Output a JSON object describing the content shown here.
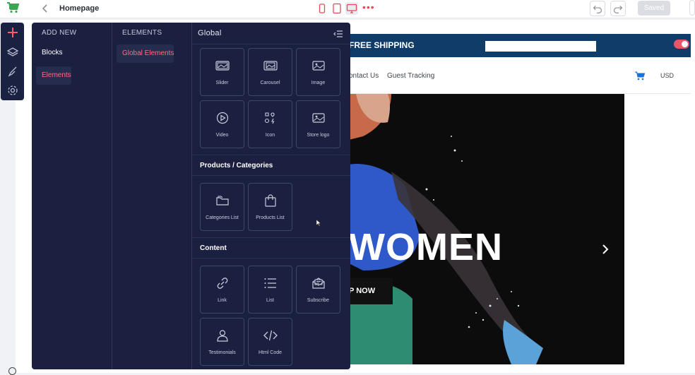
{
  "topbar": {
    "page_name": "Homepage",
    "more": "•••",
    "saved_label": "Saved",
    "icons": [
      "shop-logo-icon",
      "back-chevron-icon",
      "mobile-view-icon",
      "tablet-view-icon",
      "desktop-view-icon",
      "undo-icon",
      "redo-icon"
    ]
  },
  "toolrail": {
    "icons": [
      "add-icon",
      "layers-icon",
      "brush-icon",
      "settings-icon"
    ]
  },
  "panel": {
    "col1": {
      "heading": "ADD NEW",
      "items": [
        {
          "label": "Blocks",
          "active": false
        },
        {
          "label": "Elements",
          "active": true
        }
      ]
    },
    "col2": {
      "heading": "ELEMENTS",
      "items": [
        {
          "label": "Global Elements",
          "active": true
        }
      ]
    },
    "col3": {
      "heading": "Global",
      "global_tiles": [
        "Slider",
        "Carousel",
        "Image",
        "Video",
        "Icon",
        "Store logo"
      ],
      "section_products": "Products / Categories",
      "products_tiles": [
        "Categories List",
        "Products List"
      ],
      "section_content": "Content",
      "content_tiles": [
        "Link",
        "List",
        "Subscribe",
        "Testimonials",
        "Html Code"
      ]
    }
  },
  "store": {
    "banner_text": "FREE SHIPPING",
    "nav_links": [
      "ontact Us",
      "Guest Tracking"
    ],
    "currency": "USD",
    "hero_title": "WOMEN",
    "hero_button": "P NOW",
    "accent": "#0f3c68",
    "toggle_color": "#e8556a"
  }
}
